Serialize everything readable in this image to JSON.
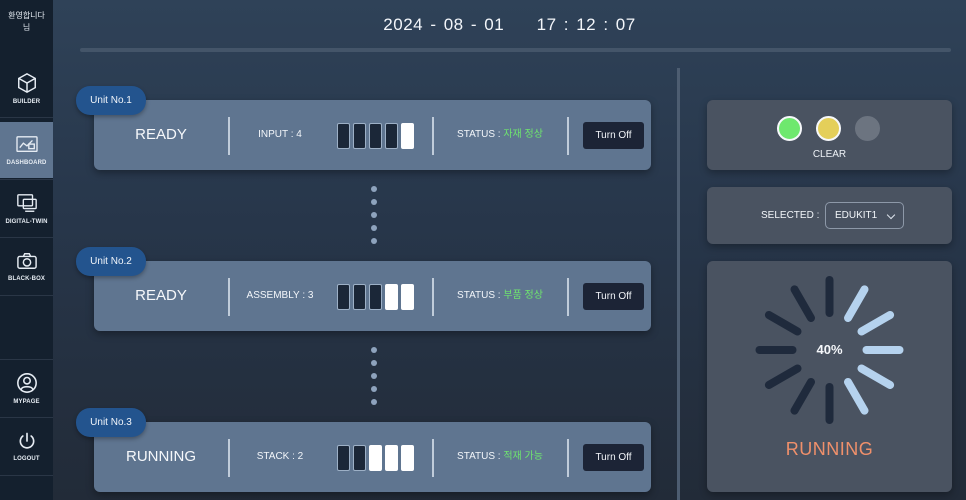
{
  "sidebar": {
    "welcome": "환영합니다\n님",
    "items": [
      {
        "label": "BUILDER",
        "icon": "cube-icon",
        "active": false
      },
      {
        "label": "DASHBOARD",
        "icon": "dashboard-icon",
        "active": true
      },
      {
        "label": "DIGITAL-TWIN",
        "icon": "monitor-icon",
        "active": false
      },
      {
        "label": "BLACK-BOX",
        "icon": "camera-icon",
        "active": false
      }
    ],
    "bottom": [
      {
        "label": "MYPAGE",
        "icon": "user-icon"
      },
      {
        "label": "LOGOUT",
        "icon": "power-icon"
      }
    ]
  },
  "header": {
    "date": "2024 - 08 - 01",
    "time": "17 : 12 : 07"
  },
  "units": [
    {
      "tag": "Unit No.1",
      "state": "READY",
      "count_label": "INPUT : 4",
      "bars": [
        false,
        false,
        false,
        false,
        true
      ],
      "status_prefix": "STATUS : ",
      "status_value": "자재 정상",
      "button": "Turn Off"
    },
    {
      "tag": "Unit No.2",
      "state": "READY",
      "count_label": "ASSEMBLY : 3",
      "bars": [
        false,
        false,
        false,
        true,
        true
      ],
      "status_prefix": "STATUS : ",
      "status_value": "부품 정상",
      "button": "Turn Off"
    },
    {
      "tag": "Unit No.3",
      "state": "RUNNING",
      "count_label": "STACK : 2",
      "bars": [
        false,
        false,
        true,
        true,
        true
      ],
      "status_prefix": "STATUS : ",
      "status_value": "적재 가능",
      "button": "Turn Off"
    }
  ],
  "signal": {
    "lights": [
      {
        "name": "green",
        "color": "#6ee86e"
      },
      {
        "name": "yellow",
        "color": "#e4cf5a"
      },
      {
        "name": "off",
        "color": "#6c7480"
      }
    ],
    "label": "CLEAR"
  },
  "selector": {
    "label": "SELECTED :",
    "value": "EDUKIT1"
  },
  "progress": {
    "percent_text": "40%",
    "percent": 40,
    "state": "RUNNING"
  },
  "colors": {
    "accent": "#23548e",
    "ok": "#6fe36f",
    "running": "#f0906b"
  }
}
